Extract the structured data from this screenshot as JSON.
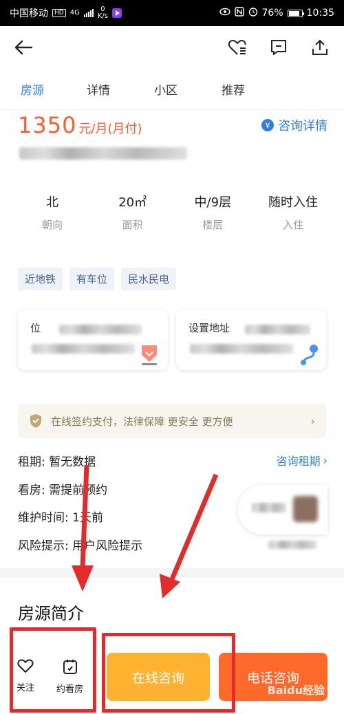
{
  "status_bar": {
    "carrier": "中国移动",
    "hd": "HD",
    "net": "4G",
    "speed_top": "0",
    "speed_unit": "K/s",
    "battery": "76%",
    "time": "10:35"
  },
  "tabs": [
    {
      "label": "房源",
      "active": true
    },
    {
      "label": "详情",
      "active": false
    },
    {
      "label": "小区",
      "active": false
    },
    {
      "label": "推荐",
      "active": false
    }
  ],
  "listing": {
    "price": "1350",
    "price_unit": "元/月(月付)",
    "consult_details": "咨询详情",
    "stats": [
      {
        "value": "北",
        "label": "朝向"
      },
      {
        "value": "20㎡",
        "label": "面积"
      },
      {
        "value": "中/9层",
        "label": "楼层"
      },
      {
        "value": "随时入住",
        "label": "入住"
      }
    ],
    "tags": [
      "近地铁",
      "有车位",
      "民水民电"
    ],
    "card_left_title": "位",
    "card_right_title": "设置地址",
    "banner": "在线签约支付，法律保障 更安全 更方便",
    "banner_arrow": "›",
    "info_rows": [
      {
        "label": "租期: 暂无数据",
        "right": "咨询租期",
        "right_arrow": "›"
      },
      {
        "label": "看房: 需提前预约",
        "right": ""
      },
      {
        "label": "维护时间: 1天前",
        "right": ""
      },
      {
        "label": "风险提示: 用户风险提示",
        "right": ""
      }
    ],
    "section_title": "房源简介"
  },
  "bottom_bar": {
    "follow": "关注",
    "appointment": "约看房",
    "online_consult": "在线咨询",
    "phone_consult": "电话咨询"
  },
  "watermark": "Baidu经验",
  "colors": {
    "accent_blue": "#2f7fe0",
    "price_orange": "#ff5a2d",
    "consult_yellow": "#ffb12f",
    "phone_orange": "#ff6a2a",
    "annotation_red": "#e22b2b"
  }
}
